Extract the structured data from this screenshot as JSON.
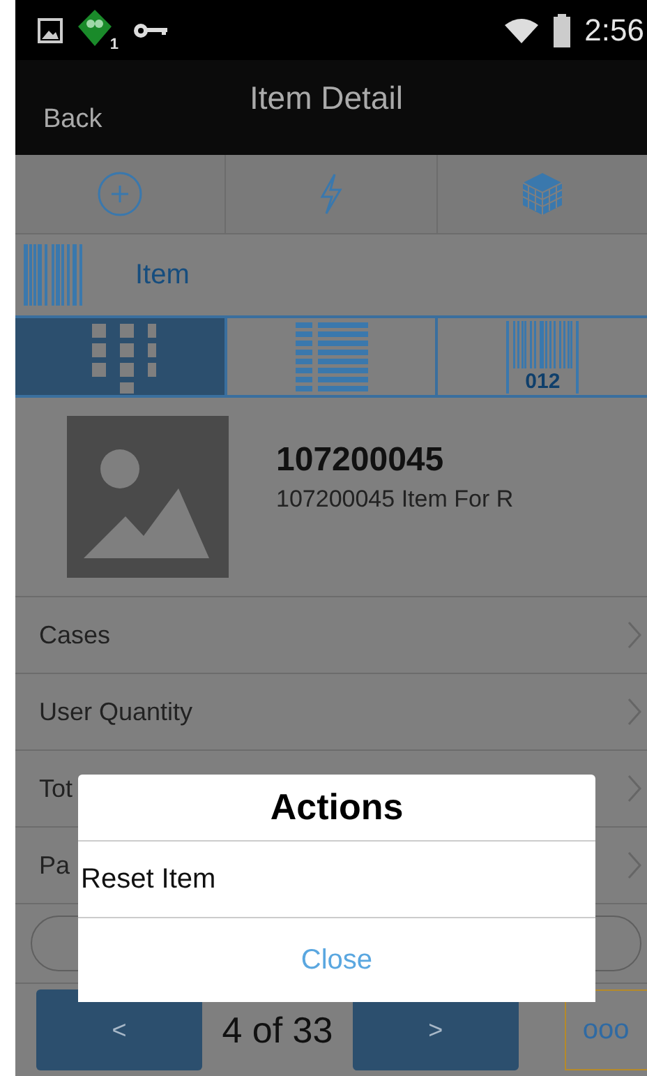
{
  "status_bar": {
    "notification_count": "1",
    "time": "2:56"
  },
  "header": {
    "back": "Back",
    "title": "Item Detail"
  },
  "section": {
    "label": "Item"
  },
  "tabs": [
    {
      "kind": "grid",
      "selected": true
    },
    {
      "kind": "list",
      "selected": false
    },
    {
      "kind": "barcode",
      "caption": "012",
      "selected": false
    }
  ],
  "item": {
    "number": "107200045",
    "description": "107200045 Item For R"
  },
  "fields": [
    {
      "label": "Cases"
    },
    {
      "label": "User Quantity"
    },
    {
      "label": "Tot"
    },
    {
      "label": "Pa"
    }
  ],
  "pager": {
    "previous": "<",
    "position": "4 of 33",
    "next": ">",
    "more": "ooo"
  },
  "dialog": {
    "title": "Actions",
    "actions": [
      "Reset Item"
    ],
    "close": "Close"
  }
}
